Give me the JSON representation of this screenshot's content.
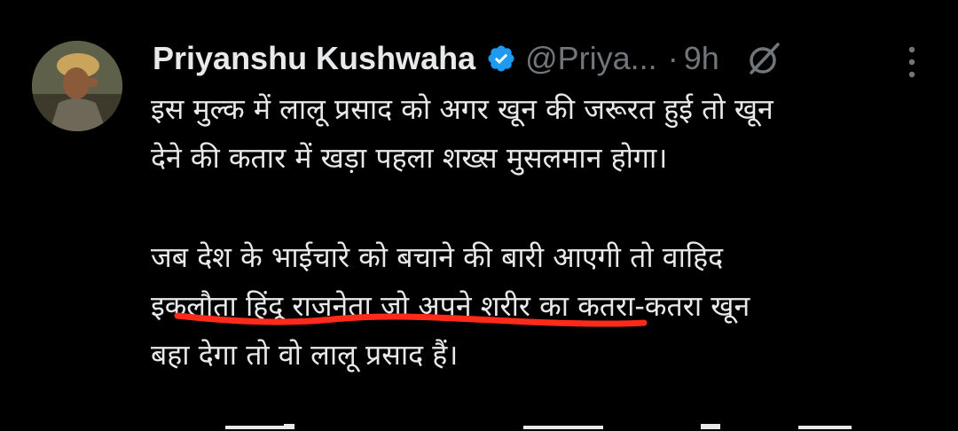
{
  "tweet": {
    "author_name": "Priyanshu Kushwaha",
    "handle": "@Priya...",
    "separator": "·",
    "time": "9h",
    "avatar_icon": "avatar-photo",
    "verified_icon": "verified-badge-icon",
    "grok_icon": "grok-icon",
    "more_icon": "more-vertical-icon",
    "colors": {
      "background": "#000000",
      "text": "#e7e9ea",
      "muted": "#71767b",
      "verified": "#1d9bf0",
      "underline": "#ff2a1a"
    },
    "paragraph1": {
      "line1": "इस मुल्क में लालू प्रसाद को अगर खून की जरूरत हुई तो खून",
      "line2": "देने की कतार में खड़ा पहला शख्स मुसलमान होगा।"
    },
    "paragraph2": {
      "line1": "जब देश के भाईचारे को बचाने की बारी आएगी तो वाहिद",
      "line2": "इकलौता हिंदू राजनेता जो अपने शरीर का कतरा-कतरा खून",
      "line3": "बहा देगा तो वो लालू प्रसाद हैं।"
    }
  }
}
